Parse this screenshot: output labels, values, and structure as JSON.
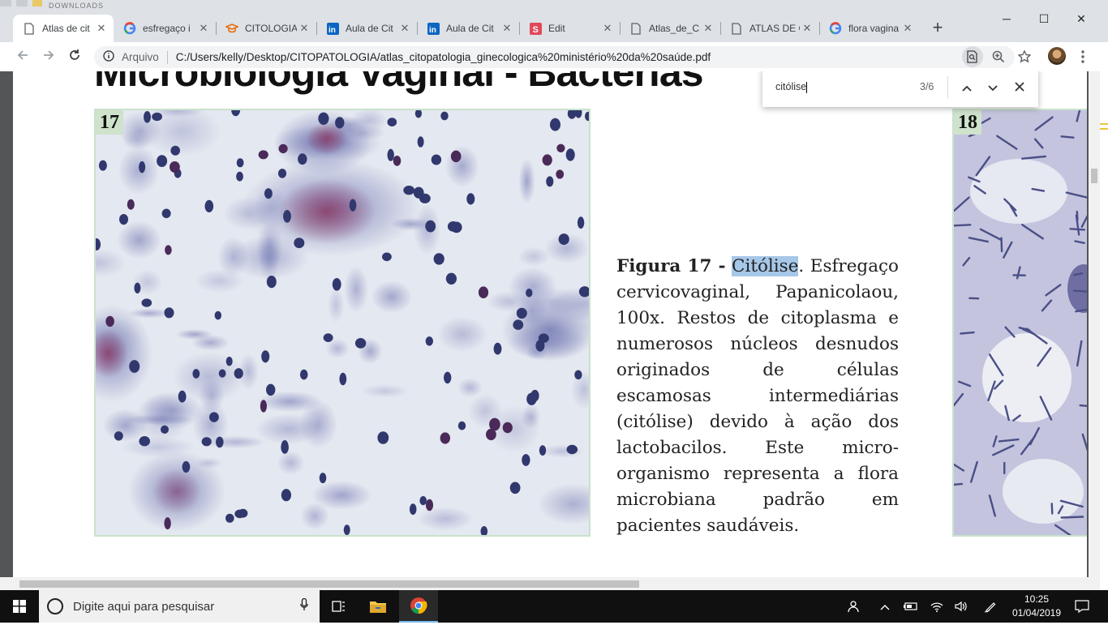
{
  "browser": {
    "background_tab_text": "DOWNLOADS",
    "tabs": [
      {
        "title": "Atlas de cit",
        "icon": "document-icon",
        "active": true
      },
      {
        "title": "esfregaço i",
        "icon": "google-icon"
      },
      {
        "title": "CITOLOGIA",
        "icon": "graduation-cap-icon"
      },
      {
        "title": "Aula de Cit",
        "icon": "linkedin-icon"
      },
      {
        "title": "Aula de Cit",
        "icon": "linkedin-icon"
      },
      {
        "title": "Edit",
        "icon": "slides-s-icon"
      },
      {
        "title": "Atlas_de_C",
        "icon": "document-icon"
      },
      {
        "title": "ATLAS DE C",
        "icon": "document-icon"
      },
      {
        "title": "flora vagina",
        "icon": "google-icon"
      }
    ],
    "new_tab_label": "+",
    "window_controls": {
      "minimize": "─",
      "maximize": "☐",
      "close": "✕"
    },
    "address": {
      "scheme_label": "Arquivo",
      "path": "C:/Users/kelly/Desktop/CITOPATOLOGIA/atlas_citopatologia_ginecologica%20ministério%20da%20saúde.pdf"
    },
    "tab_close_glyph": "✕"
  },
  "find": {
    "query": "citólise",
    "count": "3/6",
    "prev_glyph": "⌃",
    "next_glyph": "⌄",
    "close_glyph": "✕"
  },
  "document": {
    "heading": "Microbiologia Vaginal - Bactérias",
    "figure_17_number": "17",
    "figure_18_number": "18",
    "caption": {
      "label": "Figura 17 -",
      "highlight": "Citólise",
      "text": ". Esfregaço cervicovaginal, Papanicolaou, 100x. Restos de citoplasma e numerosos núcleos desnudos originados de células escamosas intermediárias (citólise) devido à ação dos lactobacilos. Este micro-organismo representa a flora microbiana padrão em pacientes saudáveis."
    }
  },
  "taskbar": {
    "search_placeholder": "Digite aqui para pesquisar",
    "time": "10:25",
    "date": "01/04/2019"
  },
  "colors": {
    "tabstrip": "#dee1e6",
    "find_highlight": "#a6c7e8",
    "figure_border": "#c9e2cc",
    "taskbar": "#101010"
  }
}
